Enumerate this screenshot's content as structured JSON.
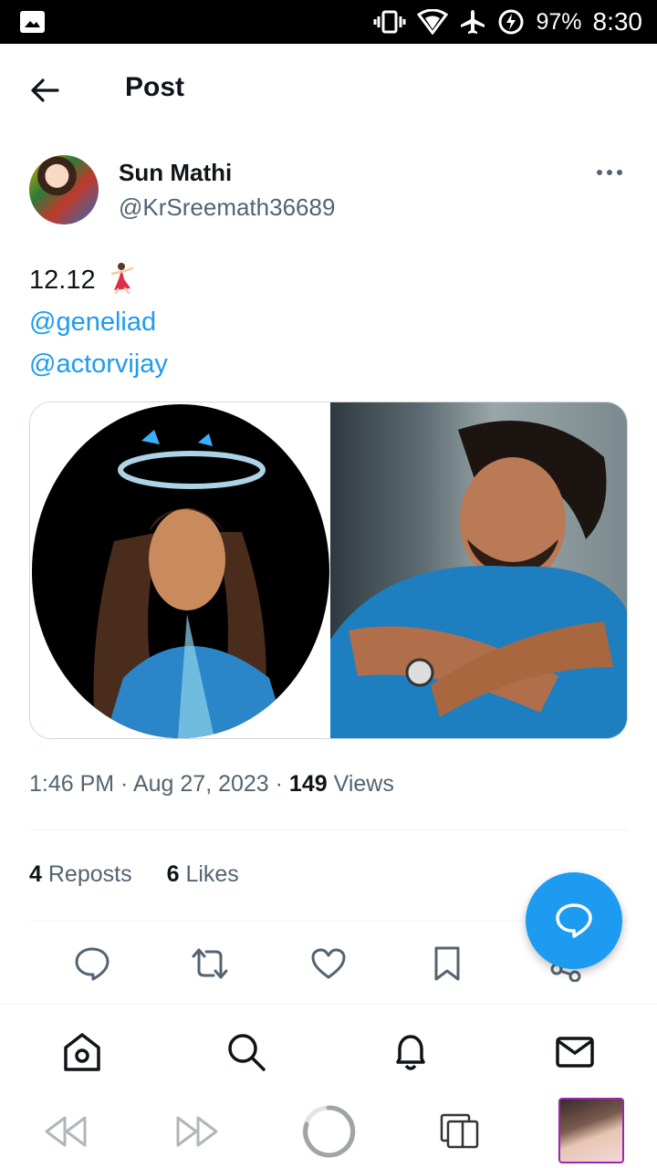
{
  "status_bar": {
    "battery": "97%",
    "time": "8:30"
  },
  "header": {
    "title": "Post"
  },
  "post": {
    "author_name": "Sun Mathi",
    "author_handle": "@KrSreemath36689",
    "text_line1": "12.12",
    "mentions": [
      "@geneliad",
      "@actorvijay"
    ],
    "time": "1:46 PM",
    "date": "Aug 27, 2023",
    "views_count": "149",
    "views_label": "Views",
    "reposts_count": "4",
    "reposts_label": "Reposts",
    "likes_count": "6",
    "likes_label": "Likes"
  },
  "icons": {
    "back": "arrow-left-icon",
    "more": "more-dots-icon",
    "reply": "reply-icon",
    "repost": "repost-icon",
    "like": "heart-icon",
    "bookmark": "bookmark-icon",
    "share": "share-icon",
    "compose": "compose-icon",
    "home": "home-icon",
    "search": "search-icon",
    "notifications": "bell-icon",
    "messages": "mail-icon"
  },
  "colors": {
    "accent": "#1d9bf0",
    "text": "#0f1419",
    "muted": "#536471"
  }
}
